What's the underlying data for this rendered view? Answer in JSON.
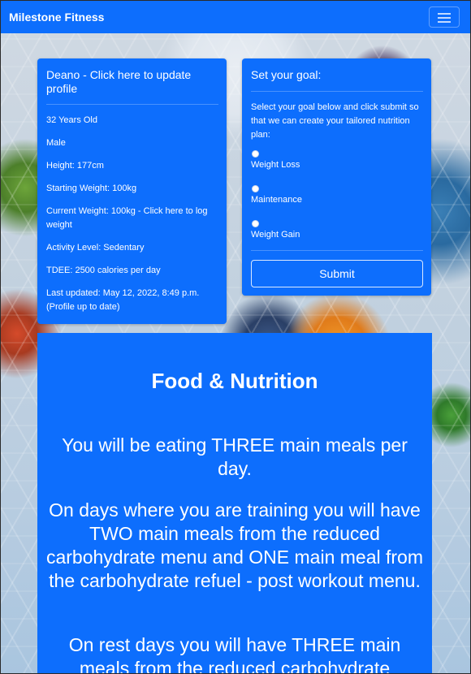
{
  "navbar": {
    "brand": "Milestone Fitness",
    "toggler_icon": "hamburger-icon"
  },
  "profile": {
    "title": "Deano - Click here to update profile",
    "age": "32 Years Old",
    "sex": "Male",
    "height": "Height: 177cm",
    "starting_weight": "Starting Weight: 100kg",
    "current_weight": "Current Weight: 100kg - Click here to log weight",
    "activity_level": "Activity Level: Sedentary",
    "tdee": "TDEE: 2500 calories per day",
    "last_updated": "Last updated: May 12, 2022, 8:49 p.m. (Profile up to date)"
  },
  "goal": {
    "title": "Set your goal:",
    "description": "Select your goal below and click submit so that we can create your tailored nutrition plan:",
    "options": [
      "Weight Loss",
      "Maintenance",
      "Weight Gain"
    ],
    "submit_label": "Submit"
  },
  "food": {
    "title": "Food & Nutrition",
    "paragraphs": [
      "You will be eating THREE main meals per day.",
      "On days where you are training you will have TWO main meals from the reduced carbohydrate menu and ONE main meal from the carbohydrate refuel - post workout menu.",
      "On rest days you will have THREE main meals from the reduced carbohydrate"
    ]
  },
  "colors": {
    "primary": "#0d6efd",
    "text_on_primary": "#ffffff"
  }
}
